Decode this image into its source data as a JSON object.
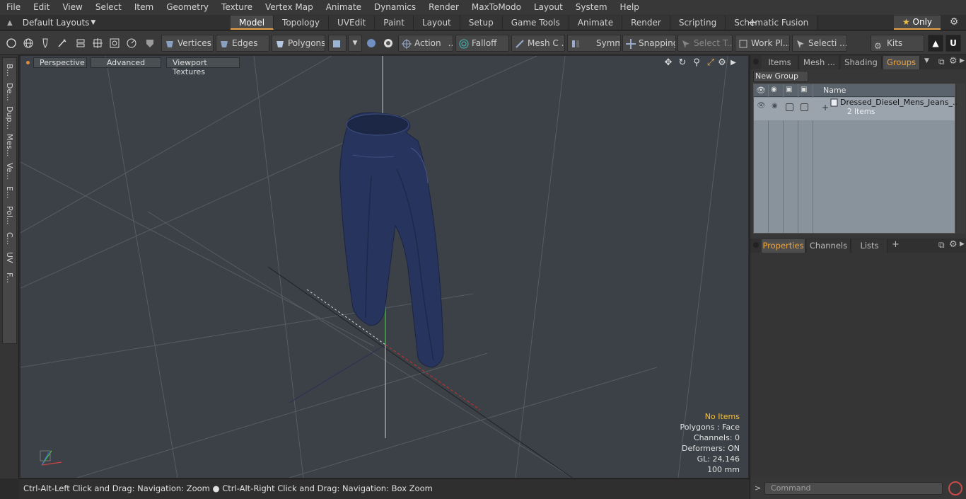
{
  "menu": [
    "File",
    "Edit",
    "View",
    "Select",
    "Item",
    "Geometry",
    "Texture",
    "Vertex Map",
    "Animate",
    "Dynamics",
    "Render",
    "MaxToModo",
    "Layout",
    "System",
    "Help"
  ],
  "layout_selector": "Default Layouts",
  "tabs": [
    "Model",
    "Topology",
    "UVEdit",
    "Paint",
    "Layout",
    "Setup",
    "Game Tools",
    "Animate",
    "Render",
    "Scripting",
    "Schematic Fusion"
  ],
  "active_tab": "Model",
  "only_label": "Only",
  "toolbar": {
    "vertices": "Vertices",
    "edges": "Edges",
    "polygons": "Polygons",
    "action": "Action",
    "falloff": "Falloff",
    "mesh": "Mesh C ...",
    "symm": "Symm ...",
    "snapping": "Snapping",
    "select_t": "Select T...",
    "work_pl": "Work Pl...",
    "selecti": "Selecti ...",
    "kits": "Kits"
  },
  "left_tabs": [
    "B...",
    "De...",
    "Dup...",
    "Mes...",
    "Ve...",
    "E...",
    "Pol...",
    "C...",
    "UV",
    "F..."
  ],
  "viewport": {
    "perspective": "Perspective",
    "advanced": "Advanced",
    "textures": "Viewport Textures"
  },
  "stats": {
    "no_items": "No Items",
    "polygons": "Polygons : Face",
    "channels": "Channels: 0",
    "deformers": "Deformers: ON",
    "gl": "GL: 24,146",
    "size": "100 mm"
  },
  "status": "Ctrl-Alt-Left Click and Drag: Navigation: Zoom ● Ctrl-Alt-Right Click and Drag: Navigation: Box Zoom",
  "right_tabs_top": [
    "Items",
    "Mesh ...",
    "Shading",
    "Groups"
  ],
  "right_active_top": "Groups",
  "new_group": "New Group",
  "groups_col_name": "Name",
  "group_item": {
    "name": "Dressed_Diesel_Mens_Jeans_...",
    "count": "2 Items"
  },
  "right_tabs_bottom": [
    "Properties",
    "Channels",
    "Lists"
  ],
  "command_placeholder": "Command",
  "colors": {
    "accent": "#e8a34a",
    "viewport_bg": "#3b4146",
    "jeans": "#27355e"
  }
}
